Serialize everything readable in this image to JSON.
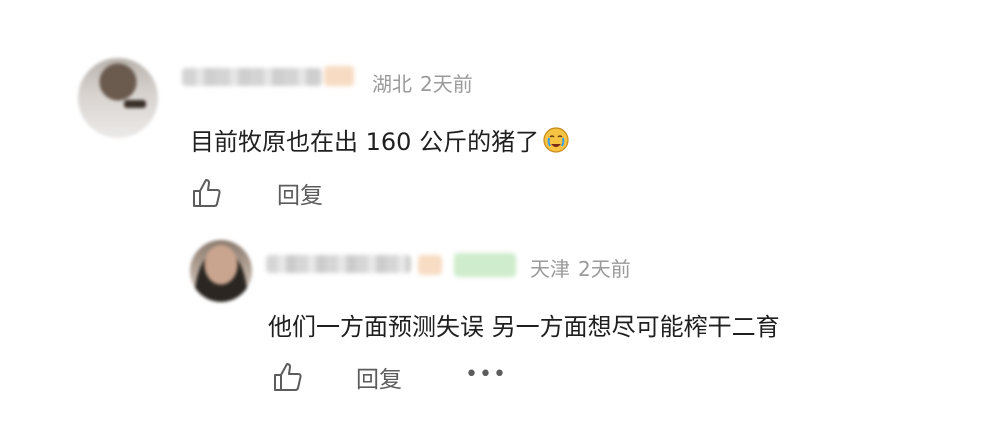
{
  "comment": {
    "location": "湖北",
    "time": "2天前",
    "text": "目前牧原也在出 160 公斤的猪了",
    "reply_label": "回复",
    "like_icon": "thumbs-up-icon"
  },
  "reply": {
    "location": "天津",
    "time": "2天前",
    "text": "他们一方面预测失误 另一方面想尽可能榨干二育",
    "reply_label": "回复",
    "more_label": "•••",
    "like_icon": "thumbs-up-icon"
  }
}
